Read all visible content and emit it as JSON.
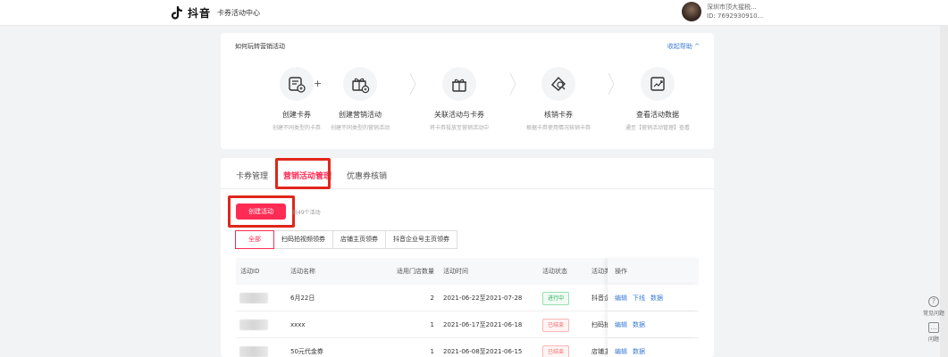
{
  "header": {
    "brand": "抖音",
    "section": "卡券活动中心",
    "user_name": "深圳市顶大猩税...",
    "user_id": "ID: 7692930910..."
  },
  "help": {
    "title": "如何玩转营销活动",
    "collapse_label": "收起帮助",
    "steps": [
      {
        "label": "创建卡券",
        "desc": "创建不同类型的卡券",
        "icon": "coupon-icon"
      },
      {
        "label": "创建营销活动",
        "desc": "创建不同类型的营销活动",
        "icon": "gift-add-icon"
      },
      {
        "label": "关联活动与卡券",
        "desc": "将卡券投放至营销活动中",
        "icon": "gift-icon"
      },
      {
        "label": "核销卡券",
        "desc": "根据卡券使用情况核销卡券",
        "icon": "verify-ticket-icon"
      },
      {
        "label": "查看活动数据",
        "desc": "通至【营销活动管理】查看",
        "icon": "trend-chart-icon"
      }
    ]
  },
  "tabs": [
    {
      "label": "卡券管理"
    },
    {
      "label": "营销活动管理"
    },
    {
      "label": "优惠券核销"
    }
  ],
  "toolbar": {
    "create_label": "创建活动",
    "count_text": "共49个活动"
  },
  "filters": [
    "全部",
    "扫码拍视频领券",
    "店铺主页领券",
    "抖音企业号主页领券"
  ],
  "table": {
    "headers": [
      "活动ID",
      "活动名称",
      "适用门店数量",
      "活动时间",
      "活动状态",
      "活动类",
      "操作"
    ],
    "rows": [
      {
        "name": "6月22日",
        "stores": "2",
        "time": "2021-06-22至2021-07-28",
        "status": "进行中",
        "status_type": "running",
        "type": "抖音企",
        "ops": [
          "编辑",
          "下线",
          "数据"
        ]
      },
      {
        "name": "xxxx",
        "stores": "1",
        "time": "2021-06-17至2021-06-18",
        "status": "已结束",
        "status_type": "ended",
        "type": "扫码拍",
        "ops": [
          "编辑",
          "数据"
        ]
      },
      {
        "name": "50元代金券",
        "stores": "1",
        "time": "2021-06-08至2021-06-15",
        "status": "已结束",
        "status_type": "ended",
        "type": "店铺主",
        "ops": [
          "编辑",
          "数据"
        ]
      }
    ]
  },
  "side_tools": [
    "常见问题",
    "问题"
  ],
  "colors": {
    "accent": "#fe2c55",
    "highlight": "#e0261b",
    "link": "#3a7bd5"
  }
}
